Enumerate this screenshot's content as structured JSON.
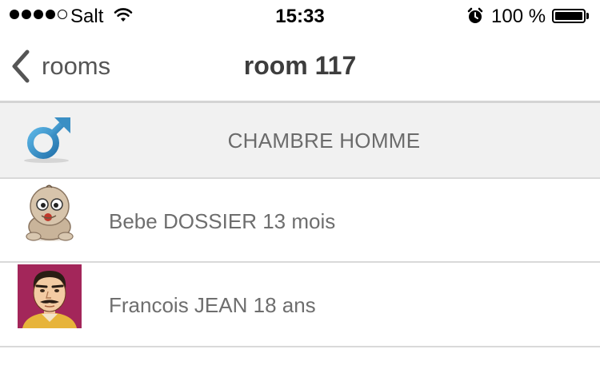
{
  "status_bar": {
    "carrier": "Salt",
    "time": "15:33",
    "battery": "100 %",
    "signal_bars_filled": 4,
    "signal_bars_total": 5
  },
  "nav": {
    "back_label": "rooms",
    "title": "room 117"
  },
  "section": {
    "title": "CHAMBRE HOMME",
    "icon": "male-symbol-icon",
    "icon_color": "#3a8fc4"
  },
  "patients": [
    {
      "label": "Bebe DOSSIER 13 mois",
      "avatar": "baby-avatar-icon"
    },
    {
      "label": "Francois JEAN 18 ans",
      "avatar": "man-avatar-icon"
    }
  ]
}
